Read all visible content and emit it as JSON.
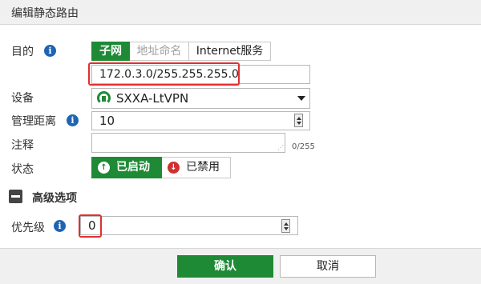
{
  "dialog": {
    "title": "编辑静态路由"
  },
  "destination": {
    "label": "目的",
    "tabs": [
      {
        "label": "子网",
        "state": "active"
      },
      {
        "label": "地址命名",
        "state": "disabled"
      },
      {
        "label": "Internet服务",
        "state": "normal"
      }
    ],
    "value": "172.0.3.0/255.255.255.0"
  },
  "device": {
    "label": "设备",
    "value": "SXXA-LtVPN",
    "icon": "vpn-tunnel-icon"
  },
  "admin_distance": {
    "label": "管理距离",
    "value": "10"
  },
  "comment": {
    "label": "注释",
    "value": "",
    "counter": "0/255"
  },
  "status": {
    "label": "状态",
    "enabled_label": "已启动",
    "disabled_label": "已禁用",
    "enabled": true
  },
  "advanced": {
    "label": "高级选项",
    "expanded": true
  },
  "priority": {
    "label": "优先级",
    "value": "0"
  },
  "footer": {
    "ok_label": "确认",
    "cancel_label": "取消"
  },
  "colors": {
    "accent": "#1f8a36",
    "highlight": "#e03030",
    "info": "#1e64b4",
    "disabled_red": "#d03030"
  }
}
